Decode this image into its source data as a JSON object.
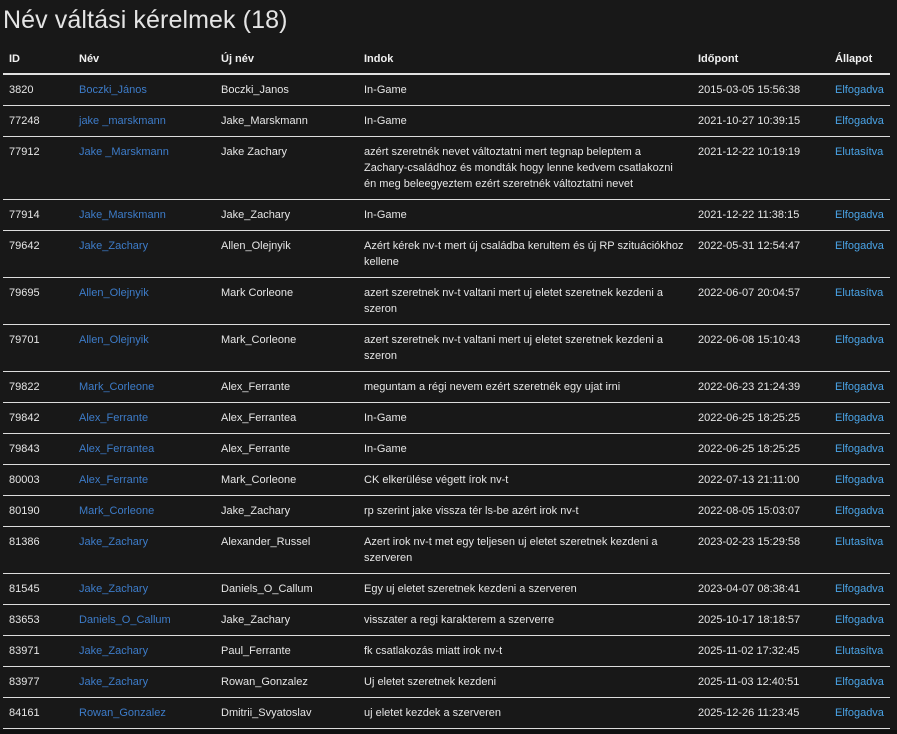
{
  "title": "Név váltási kérelmek (18)",
  "columns": [
    "ID",
    "Név",
    "Új név",
    "Indok",
    "Időpont",
    "Állapot"
  ],
  "rows": [
    {
      "id": "3820",
      "name": "Boczki_János",
      "new_name": "Boczki_Janos",
      "reason": "In-Game",
      "time": "2015-03-05 15:56:38",
      "status": "Elfogadva"
    },
    {
      "id": "77248",
      "name": "jake _marskmann",
      "new_name": "Jake_Marskmann",
      "reason": "In-Game",
      "time": "2021-10-27 10:39:15",
      "status": "Elfogadva"
    },
    {
      "id": "77912",
      "name": "Jake _Marskmann",
      "new_name": "Jake Zachary",
      "reason": "azért szeretnék nevet változtatni mert tegnap beleptem a Zachary-családhoz és mondták hogy lenne kedvem csatlakozni én meg beleegyeztem ezért szeretnék változtatni nevet",
      "time": "2021-12-22 10:19:19",
      "status": "Elutasítva"
    },
    {
      "id": "77914",
      "name": "Jake_Marskmann",
      "new_name": "Jake_Zachary",
      "reason": "In-Game",
      "time": "2021-12-22 11:38:15",
      "status": "Elfogadva"
    },
    {
      "id": "79642",
      "name": "Jake_Zachary",
      "new_name": "Allen_Olejnyik",
      "reason": "Azért kérek nv-t mert új családba kerultem és új RP szituációkhoz kellene",
      "time": "2022-05-31 12:54:47",
      "status": "Elfogadva"
    },
    {
      "id": "79695",
      "name": "Allen_Olejnyik",
      "new_name": "Mark Corleone",
      "reason": "azert szeretnek nv-t valtani mert uj eletet szeretnek kezdeni a szeron",
      "time": "2022-06-07 20:04:57",
      "status": "Elutasítva"
    },
    {
      "id": "79701",
      "name": "Allen_Olejnyik",
      "new_name": "Mark_Corleone",
      "reason": "azert szeretnek nv-t valtani mert uj eletet szeretnek kezdeni a szeron",
      "time": "2022-06-08 15:10:43",
      "status": "Elfogadva"
    },
    {
      "id": "79822",
      "name": "Mark_Corleone",
      "new_name": "Alex_Ferrante",
      "reason": "meguntam a régi nevem ezért szeretnék egy ujat irni",
      "time": "2022-06-23 21:24:39",
      "status": "Elfogadva"
    },
    {
      "id": "79842",
      "name": "Alex_Ferrante",
      "new_name": "Alex_Ferrantea",
      "reason": "In-Game",
      "time": "2022-06-25 18:25:25",
      "status": "Elfogadva"
    },
    {
      "id": "79843",
      "name": "Alex_Ferrantea",
      "new_name": "Alex_Ferrante",
      "reason": "In-Game",
      "time": "2022-06-25 18:25:25",
      "status": "Elfogadva"
    },
    {
      "id": "80003",
      "name": "Alex_Ferrante",
      "new_name": "Mark_Corleone",
      "reason": "CK elkerülése végett írok nv-t",
      "time": "2022-07-13 21:11:00",
      "status": "Elfogadva"
    },
    {
      "id": "80190",
      "name": "Mark_Corleone",
      "new_name": "Jake_Zachary",
      "reason": "rp szerint jake vissza tér ls-be azért irok nv-t",
      "time": "2022-08-05 15:03:07",
      "status": "Elfogadva"
    },
    {
      "id": "81386",
      "name": "Jake_Zachary",
      "new_name": "Alexander_Russel",
      "reason": "Azert irok nv-t met egy teljesen uj eletet szeretnek kezdeni a szerveren",
      "time": "2023-02-23 15:29:58",
      "status": "Elutasítva"
    },
    {
      "id": "81545",
      "name": "Jake_Zachary",
      "new_name": "Daniels_O_Callum",
      "reason": "Egy uj eletet szeretnek kezdeni a szerveren",
      "time": "2023-04-07 08:38:41",
      "status": "Elfogadva"
    },
    {
      "id": "83653",
      "name": "Daniels_O_Callum",
      "new_name": "Jake_Zachary",
      "reason": "visszater a regi karakterem a szerverre",
      "time": "2025-10-17 18:18:57",
      "status": "Elfogadva"
    },
    {
      "id": "83971",
      "name": "Jake_Zachary",
      "new_name": "Paul_Ferrante",
      "reason": "fk csatlakozás miatt irok nv-t",
      "time": "2025-11-02 17:32:45",
      "status": "Elutasítva"
    },
    {
      "id": "83977",
      "name": "Jake_Zachary",
      "new_name": "Rowan_Gonzalez",
      "reason": "Uj eletet szeretnek kezdeni",
      "time": "2025-11-03 12:40:51",
      "status": "Elfogadva"
    },
    {
      "id": "84161",
      "name": "Rowan_Gonzalez",
      "new_name": "Dmitrii_Svyatoslav",
      "reason": "uj eletet kezdek a szerveren",
      "time": "2025-12-26 11:23:45",
      "status": "Elfogadva"
    }
  ],
  "colors": {
    "background": "#181818",
    "name_link": "#3d7cc9",
    "status_link": "#4aa3e6",
    "text": "#e6e6e6"
  }
}
